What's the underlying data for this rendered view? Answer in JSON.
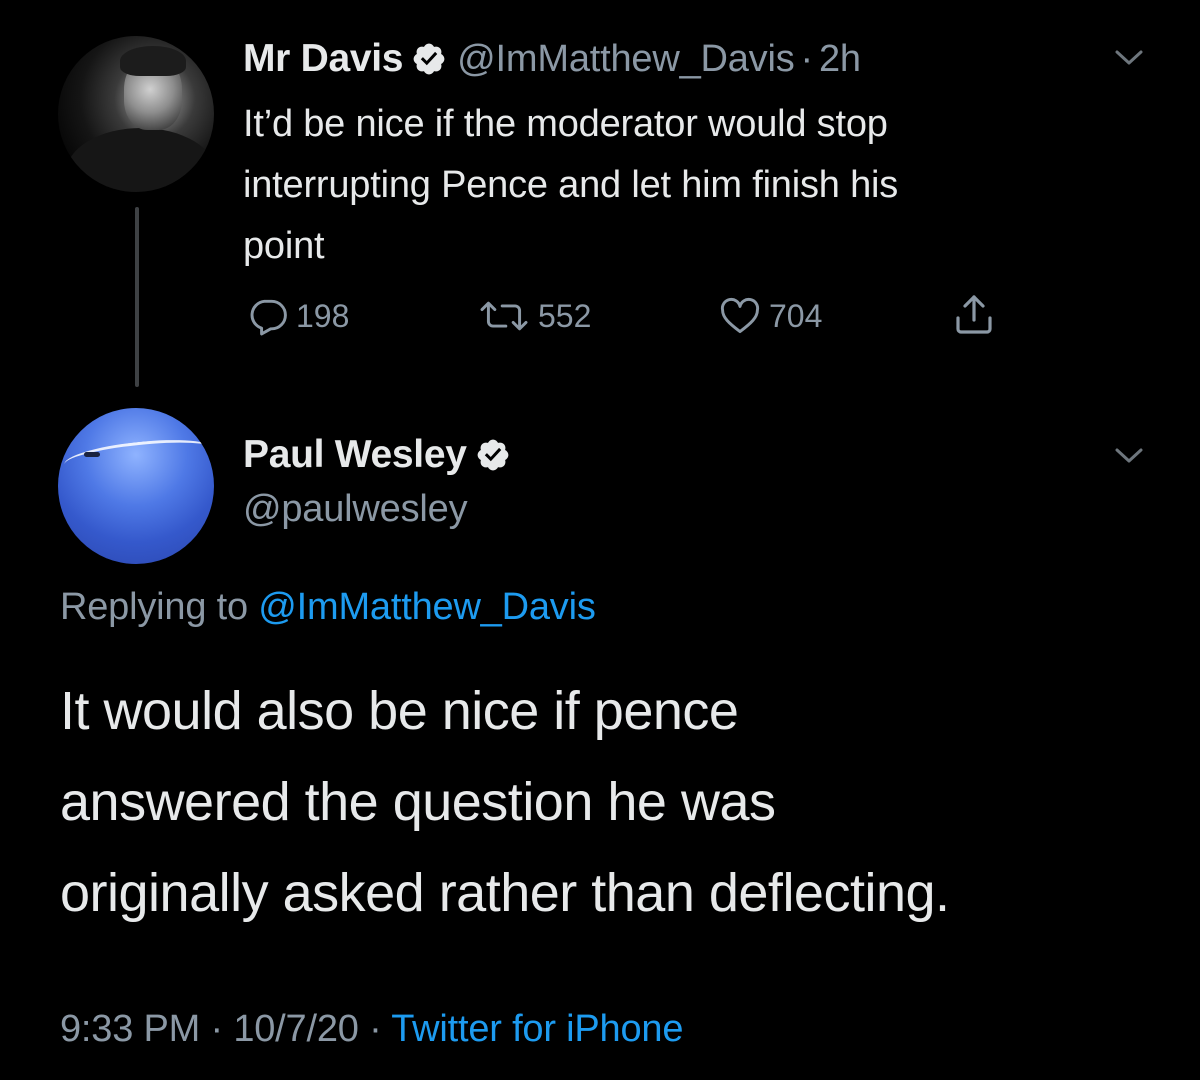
{
  "parent_tweet": {
    "display_name": "Mr Davis",
    "handle": "@ImMatthew_Davis",
    "separator": "·",
    "time_ago": "2h",
    "text_lines": [
      "It’d be nice if the moderator would stop",
      "interrupting Pence and let him finish his",
      "point"
    ],
    "reply_count": "198",
    "retweet_count": "552",
    "like_count": "704",
    "verified": true
  },
  "reply_tweet": {
    "display_name": "Paul Wesley",
    "handle": "@paulwesley",
    "replying_prefix": "Replying to",
    "replying_handle": "@ImMatthew_Davis",
    "text_lines": [
      "It would also be nice if pence",
      "answered the question he was",
      "originally asked rather than deflecting."
    ],
    "time": "9:33 PM",
    "separator": "·",
    "date": "10/7/20",
    "source": "Twitter for iPhone",
    "verified": true
  },
  "colors": {
    "background": "#000000",
    "primary_text": "#e7e9ea",
    "secondary_text": "#8b98a5",
    "link": "#1d9bf0",
    "thread_line": "#3e4144"
  },
  "icons": {
    "verified": "verified-badge-icon",
    "menu": "chevron-down-icon",
    "reply": "reply-bubble-icon",
    "retweet": "retweet-icon",
    "like": "heart-icon",
    "share": "share-icon"
  }
}
